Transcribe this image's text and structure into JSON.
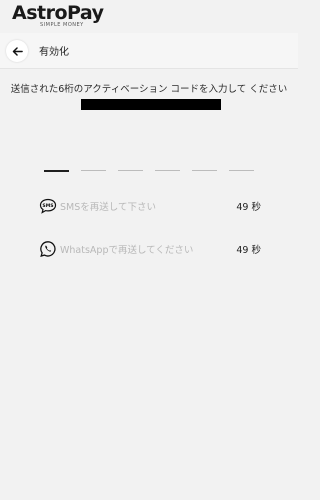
{
  "brand": {
    "name": "AstroPay",
    "tagline": "SIMPLE MONEY"
  },
  "nav": {
    "title": "有効化"
  },
  "instructions": {
    "text": "送信された6桁のアクティベーション コードを入力して ください"
  },
  "code": {
    "length": 6,
    "filled": 0
  },
  "resend_sms": {
    "label": "SMSを再送して下さい",
    "timer": "49 秒",
    "icon": "sms-icon"
  },
  "resend_whatsapp": {
    "label": "WhatsAppで再送してください",
    "timer": "49 秒",
    "icon": "whatsapp-icon"
  },
  "colors": {
    "background": "#f2f2f2",
    "text": "#1f1f1f",
    "disabled": "#b8b8b8"
  }
}
